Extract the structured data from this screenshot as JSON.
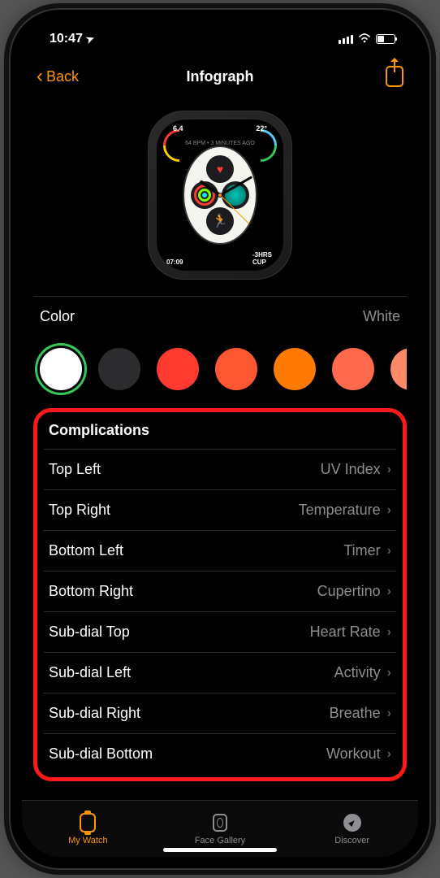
{
  "status": {
    "time": "10:47",
    "location_glyph": "➤"
  },
  "nav": {
    "back_label": "Back",
    "title": "Infograph"
  },
  "watch_preview": {
    "corner_top_left": "6.4",
    "corner_top_right": "22°",
    "top_arc_text": "64 BPM • 3 MINUTES AGO",
    "bottom_left_text": "07:09",
    "bottom_right_text": "-3HRS",
    "bottom_right_label": "CUP"
  },
  "color_section": {
    "label": "Color",
    "value": "White",
    "swatches": [
      {
        "hex": "#ffffff",
        "selected": true
      },
      {
        "hex": "#2c2c2e",
        "selected": false
      },
      {
        "hex": "#ff3b30",
        "selected": false
      },
      {
        "hex": "#ff5733",
        "selected": false
      },
      {
        "hex": "#ff7a00",
        "selected": false
      },
      {
        "hex": "#ff6a4d",
        "selected": false
      },
      {
        "hex": "#ff8866",
        "selected": false
      }
    ]
  },
  "complications": {
    "header": "Complications",
    "rows": [
      {
        "label": "Top Left",
        "value": "UV Index"
      },
      {
        "label": "Top Right",
        "value": "Temperature"
      },
      {
        "label": "Bottom Left",
        "value": "Timer"
      },
      {
        "label": "Bottom Right",
        "value": "Cupertino"
      },
      {
        "label": "Sub-dial Top",
        "value": "Heart Rate"
      },
      {
        "label": "Sub-dial Left",
        "value": "Activity"
      },
      {
        "label": "Sub-dial Right",
        "value": "Breathe"
      },
      {
        "label": "Sub-dial Bottom",
        "value": "Workout"
      }
    ]
  },
  "tabs": {
    "my_watch": "My Watch",
    "face_gallery": "Face Gallery",
    "discover": "Discover"
  }
}
